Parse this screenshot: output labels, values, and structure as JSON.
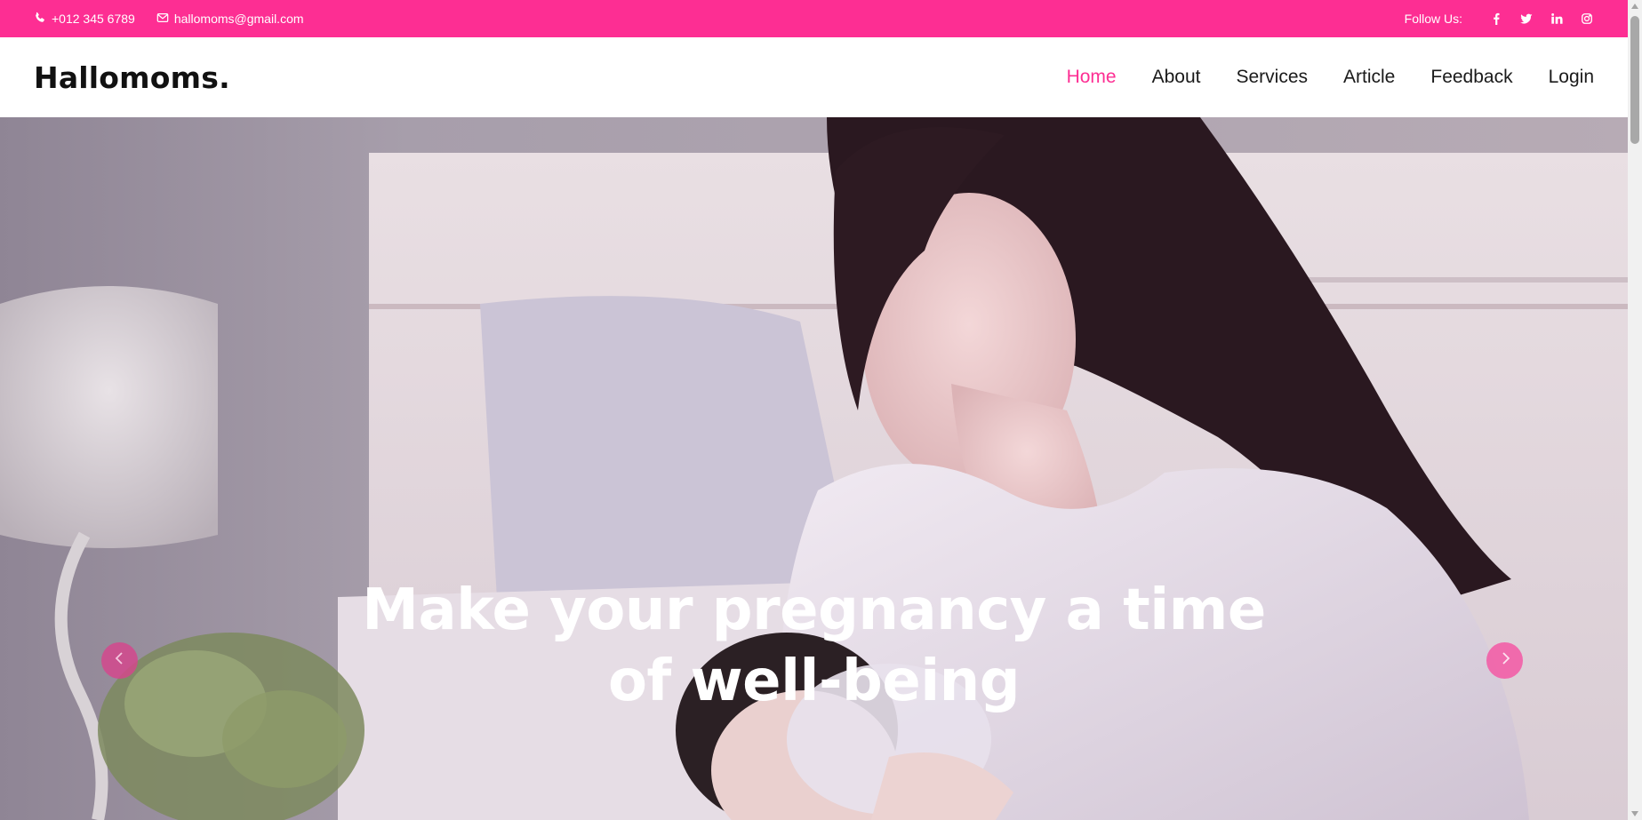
{
  "topbar": {
    "phone": "+012 345 6789",
    "email": "hallomoms@gmail.com",
    "follow_label": "Follow Us:",
    "socials": [
      "facebook-icon",
      "twitter-icon",
      "linkedin-icon",
      "instagram-icon"
    ]
  },
  "navbar": {
    "logo": "Hallomoms.",
    "links": [
      {
        "label": "Home",
        "active": true
      },
      {
        "label": "About"
      },
      {
        "label": "Services"
      },
      {
        "label": "Article"
      },
      {
        "label": "Feedback"
      },
      {
        "label": "Login"
      }
    ]
  },
  "hero": {
    "title_line1": "Make your pregnancy a time",
    "title_line2": "of well-being"
  },
  "colors": {
    "brand_pink": "#fd2e93",
    "text_dark": "#1a1a1a",
    "white": "#ffffff"
  }
}
